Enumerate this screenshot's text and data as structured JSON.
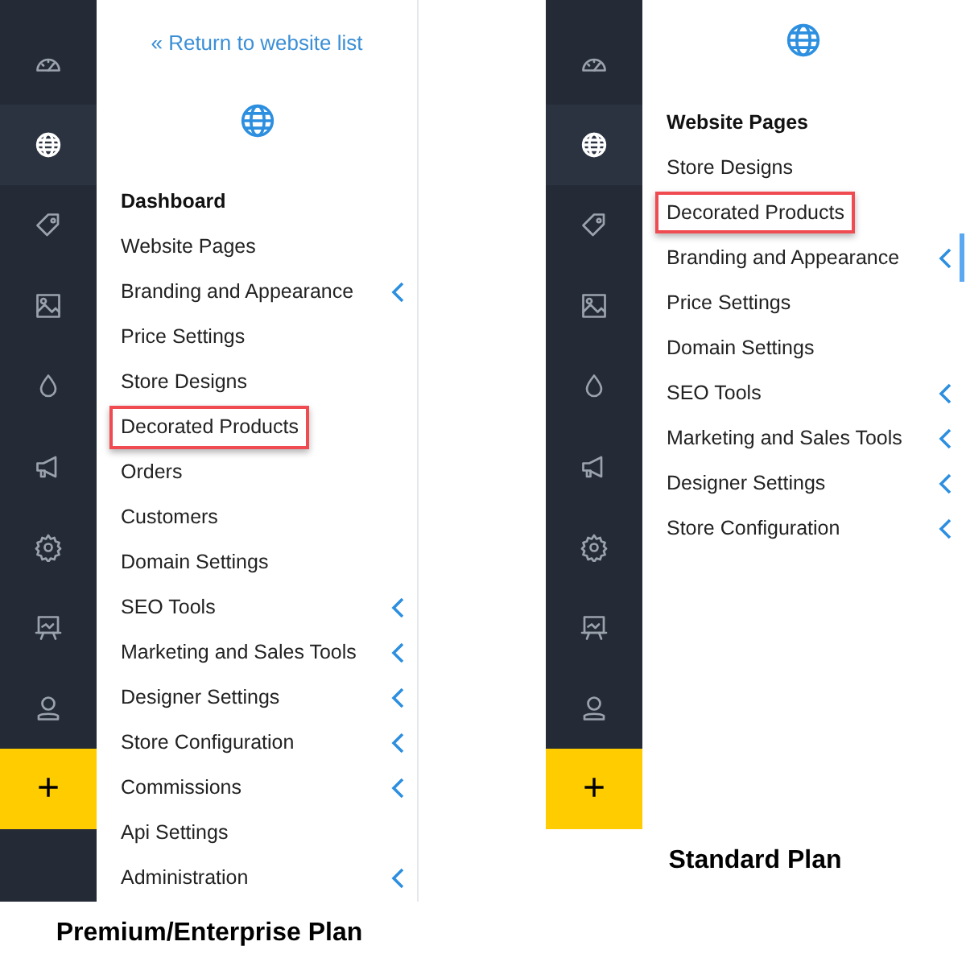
{
  "panels": [
    {
      "back_link": "« Return to website list",
      "rail": [
        {
          "kind": "gauge",
          "selected": false
        },
        {
          "kind": "globe",
          "selected": true
        },
        {
          "kind": "tag",
          "selected": false
        },
        {
          "kind": "image",
          "selected": false
        },
        {
          "kind": "drop",
          "selected": false
        },
        {
          "kind": "megaphone",
          "selected": false
        },
        {
          "kind": "gear",
          "selected": false
        },
        {
          "kind": "board",
          "selected": false
        },
        {
          "kind": "user",
          "selected": false
        }
      ],
      "add_label": "+",
      "rail_tail": true,
      "scrollbar": false,
      "items": [
        {
          "label": "Dashboard",
          "selected": true,
          "highlighted": false,
          "expandable": false
        },
        {
          "label": "Website Pages",
          "selected": false,
          "highlighted": false,
          "expandable": false
        },
        {
          "label": "Branding and Appearance",
          "selected": false,
          "highlighted": false,
          "expandable": true
        },
        {
          "label": "Price Settings",
          "selected": false,
          "highlighted": false,
          "expandable": false
        },
        {
          "label": "Store Designs",
          "selected": false,
          "highlighted": false,
          "expandable": false
        },
        {
          "label": "Decorated Products",
          "selected": false,
          "highlighted": true,
          "expandable": false
        },
        {
          "label": "Orders",
          "selected": false,
          "highlighted": false,
          "expandable": false
        },
        {
          "label": "Customers",
          "selected": false,
          "highlighted": false,
          "expandable": false
        },
        {
          "label": "Domain Settings",
          "selected": false,
          "highlighted": false,
          "expandable": false
        },
        {
          "label": "SEO Tools",
          "selected": false,
          "highlighted": false,
          "expandable": true
        },
        {
          "label": "Marketing and Sales Tools",
          "selected": false,
          "highlighted": false,
          "expandable": true
        },
        {
          "label": "Designer Settings",
          "selected": false,
          "highlighted": false,
          "expandable": true
        },
        {
          "label": "Store Configuration",
          "selected": false,
          "highlighted": false,
          "expandable": true
        },
        {
          "label": "Commissions",
          "selected": false,
          "highlighted": false,
          "expandable": true
        },
        {
          "label": "Api Settings",
          "selected": false,
          "highlighted": false,
          "expandable": false
        },
        {
          "label": "Administration",
          "selected": false,
          "highlighted": false,
          "expandable": true
        }
      ],
      "caption": "Premium/Enterprise Plan"
    },
    {
      "rail": [
        {
          "kind": "gauge",
          "selected": false
        },
        {
          "kind": "globe",
          "selected": true
        },
        {
          "kind": "tag",
          "selected": false
        },
        {
          "kind": "image",
          "selected": false
        },
        {
          "kind": "drop",
          "selected": false
        },
        {
          "kind": "megaphone",
          "selected": false
        },
        {
          "kind": "gear",
          "selected": false
        },
        {
          "kind": "board",
          "selected": false
        },
        {
          "kind": "user",
          "selected": false
        }
      ],
      "add_label": "+",
      "rail_tail": false,
      "scrollbar": true,
      "items": [
        {
          "label": "Website Pages",
          "selected": true,
          "highlighted": false,
          "expandable": false
        },
        {
          "label": "Store Designs",
          "selected": false,
          "highlighted": false,
          "expandable": false
        },
        {
          "label": "Decorated Products",
          "selected": false,
          "highlighted": true,
          "expandable": false
        },
        {
          "label": "Branding and Appearance",
          "selected": false,
          "highlighted": false,
          "expandable": true
        },
        {
          "label": "Price Settings",
          "selected": false,
          "highlighted": false,
          "expandable": false
        },
        {
          "label": "Domain Settings",
          "selected": false,
          "highlighted": false,
          "expandable": false
        },
        {
          "label": "SEO Tools",
          "selected": false,
          "highlighted": false,
          "expandable": true
        },
        {
          "label": "Marketing and Sales Tools",
          "selected": false,
          "highlighted": false,
          "expandable": true
        },
        {
          "label": "Designer Settings",
          "selected": false,
          "highlighted": false,
          "expandable": true
        },
        {
          "label": "Store Configuration",
          "selected": false,
          "highlighted": false,
          "expandable": true
        }
      ],
      "caption": "Standard Plan"
    }
  ]
}
